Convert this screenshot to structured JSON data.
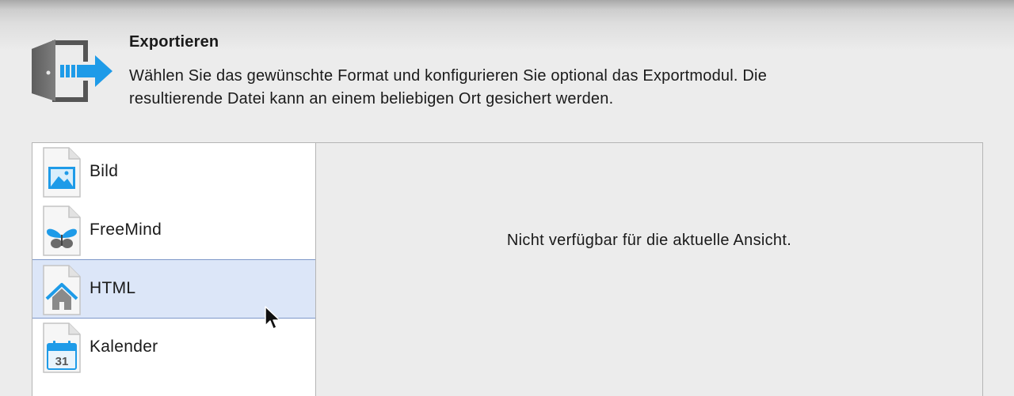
{
  "header": {
    "title": "Exportieren",
    "description_line1": "Wählen Sie das gewünschte Format und konfigurieren Sie optional das Exportmodul. Die",
    "description_line2": "resultierende Datei kann an einem beliebigen Ort gesichert werden.",
    "icon": "export-door-arrow-icon"
  },
  "formats": {
    "items": [
      {
        "label": "Bild",
        "icon": "image-file-icon",
        "selected": false
      },
      {
        "label": "FreeMind",
        "icon": "freemind-butterfly-file-icon",
        "selected": false
      },
      {
        "label": "HTML",
        "icon": "html-house-file-icon",
        "selected": true
      },
      {
        "label": "Kalender",
        "icon": "calendar-file-icon",
        "calendar_day": "31",
        "selected": false
      }
    ]
  },
  "detail": {
    "message": "Nicht verfügbar für die aktuelle Ansicht."
  },
  "colors": {
    "accent_blue": "#1e9be8",
    "selection_bg": "#dce6f8",
    "selection_border": "#7d97c9"
  }
}
